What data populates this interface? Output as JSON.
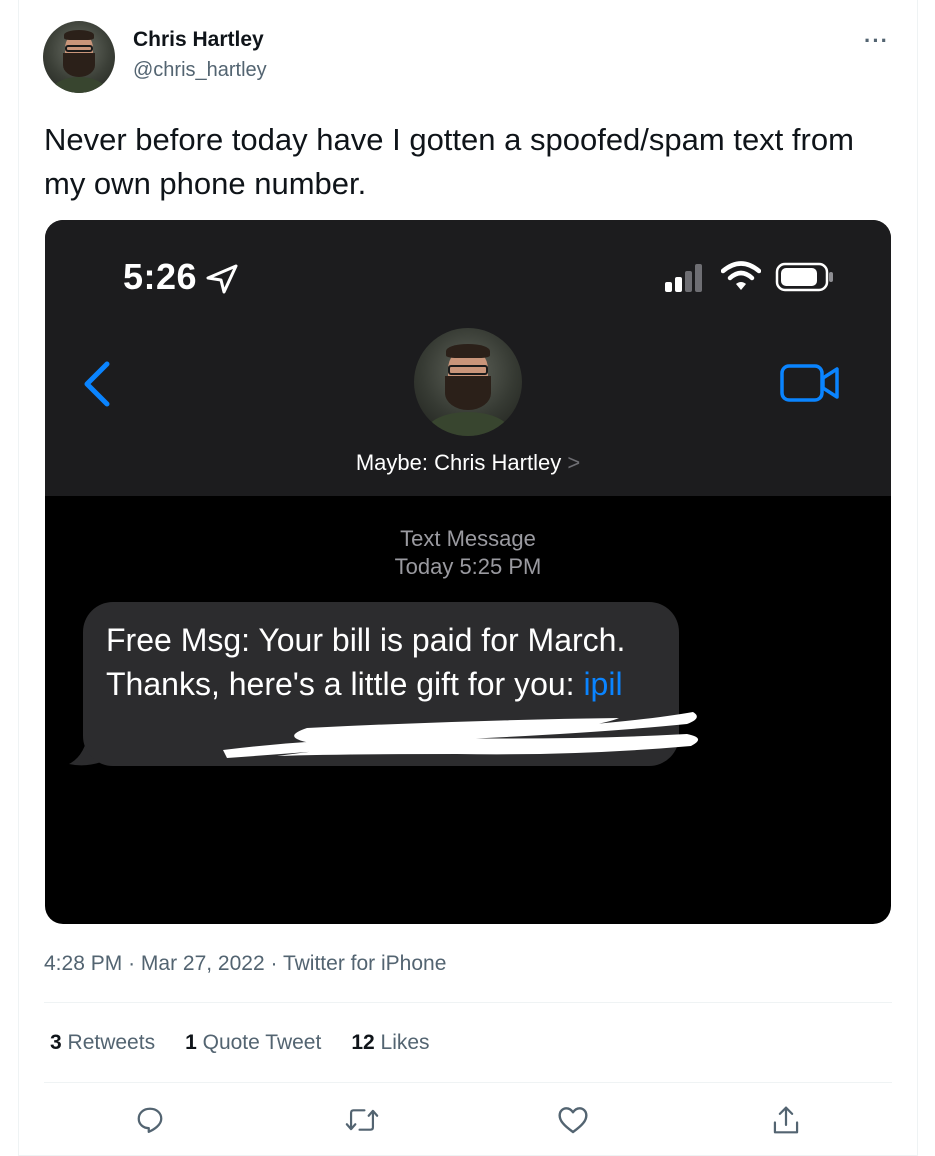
{
  "author": {
    "name": "Chris Hartley",
    "handle": "@chris_hartley"
  },
  "tweet": {
    "text": "Never before today have I gotten a spoofed/spam text from my own phone number."
  },
  "screenshot": {
    "status_time": "5:26",
    "contact_name": "Maybe: Chris Hartley",
    "contact_chevron": ">",
    "message_label": "Text Message",
    "message_time": "Today 5:25 PM",
    "message_text": "Free Msg: Your bill is paid for March. Thanks, here's a little gift for you:",
    "message_link_fragment": "ipil",
    "accent_color": "#0a84ff"
  },
  "meta": {
    "time": "4:28 PM",
    "separator": "·",
    "date": "Mar 27, 2022",
    "source": "Twitter for iPhone"
  },
  "stats": {
    "retweets_count": "3",
    "retweets_label": "Retweets",
    "quotes_count": "1",
    "quotes_label": "Quote Tweet",
    "likes_count": "12",
    "likes_label": "Likes"
  },
  "actions": [
    "reply-icon",
    "retweet-icon",
    "like-icon",
    "share-icon"
  ]
}
